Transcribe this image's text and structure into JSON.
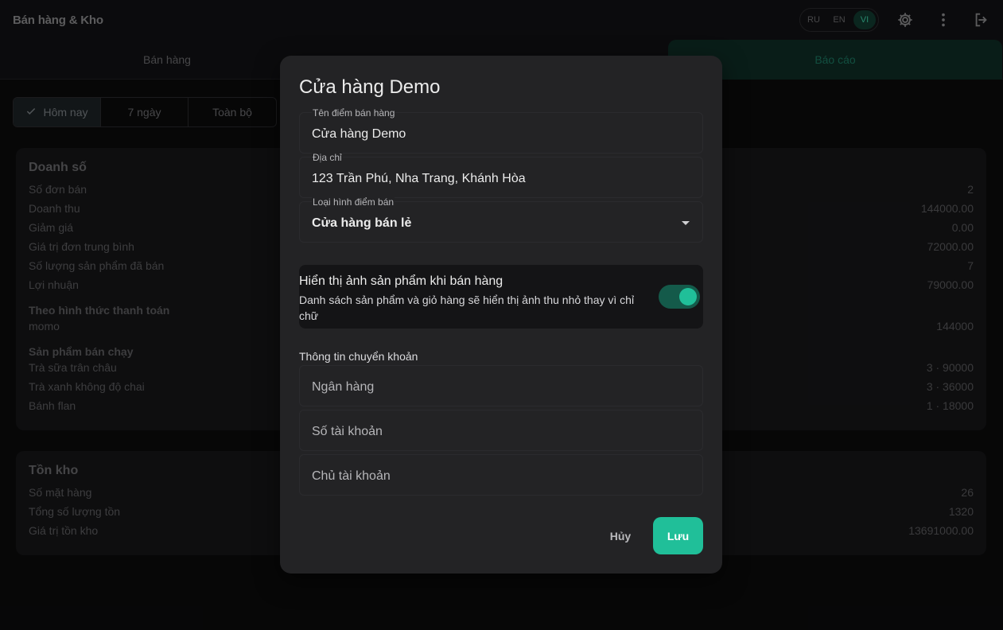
{
  "app": {
    "title": "Bán hàng & Kho",
    "languages": [
      {
        "code": "RU",
        "active": false
      },
      {
        "code": "EN",
        "active": false
      },
      {
        "code": "VI",
        "active": true
      }
    ],
    "icons": [
      "gear-icon",
      "more-vert-icon",
      "logout-icon"
    ]
  },
  "tabs": [
    {
      "label": "Bán hàng",
      "active": false
    },
    {
      "label": "Báo cáo",
      "active": true
    }
  ],
  "filters": [
    {
      "label": "Hôm nay",
      "active": true
    },
    {
      "label": "7 ngày",
      "active": false
    },
    {
      "label": "Toàn bộ",
      "active": false
    }
  ],
  "sales_card": {
    "title": "Doanh số",
    "rows": [
      {
        "label": "Số đơn bán",
        "value": "2"
      },
      {
        "label": "Doanh thu",
        "value": "144000.00"
      },
      {
        "label": "Giảm giá",
        "value": "0.00"
      },
      {
        "label": "Giá trị đơn trung bình",
        "value": "72000.00"
      },
      {
        "label": "Số lượng sản phẩm đã bán",
        "value": "7"
      },
      {
        "label": "Lợi nhuận",
        "value": "79000.00"
      }
    ],
    "payment_heading": "Theo hình thức thanh toán",
    "payment_rows": [
      {
        "label": "momo",
        "value": "144000"
      }
    ],
    "top_heading": "Sản phẩm bán chạy",
    "top_rows": [
      {
        "label": "Trà sữa trân châu",
        "value": "3 · 90000"
      },
      {
        "label": "Trà xanh không độ chai",
        "value": "3 · 36000"
      },
      {
        "label": "Bánh flan",
        "value": "1 · 18000"
      }
    ]
  },
  "stock_card": {
    "title": "Tồn kho",
    "rows": [
      {
        "label": "Số mặt hàng",
        "value": "26"
      },
      {
        "label": "Tổng số lượng tồn",
        "value": "1320"
      },
      {
        "label": "Giá trị tồn kho",
        "value": "13691000.00"
      }
    ]
  },
  "dialog": {
    "title": "Cửa hàng Demo",
    "name_field": {
      "label": "Tên điểm bán hàng",
      "value": "Cửa hàng Demo"
    },
    "address_field": {
      "label": "Địa chỉ",
      "value": "123 Trần Phú, Nha Trang, Khánh Hòa"
    },
    "type_field": {
      "label": "Loại hình điểm bán",
      "value": "Cửa hàng bán lẻ"
    },
    "toggle": {
      "title": "Hiển thị ảnh sản phẩm khi bán hàng",
      "description": "Danh sách sản phẩm và giỏ hàng sẽ hiển thị ảnh thu nhỏ thay vì chỉ chữ",
      "on": true
    },
    "transfer_label": "Thông tin chuyển khoản",
    "bank_field": {
      "placeholder": "Ngân hàng"
    },
    "account_field": {
      "placeholder": "Số tài khoản"
    },
    "holder_field": {
      "placeholder": "Chủ tài khoản"
    },
    "cancel_label": "Hủy",
    "save_label": "Lưu"
  },
  "colors": {
    "accent": "#20bf99",
    "dialog_bg": "#232325",
    "page_bg": "#0b0b0c"
  }
}
